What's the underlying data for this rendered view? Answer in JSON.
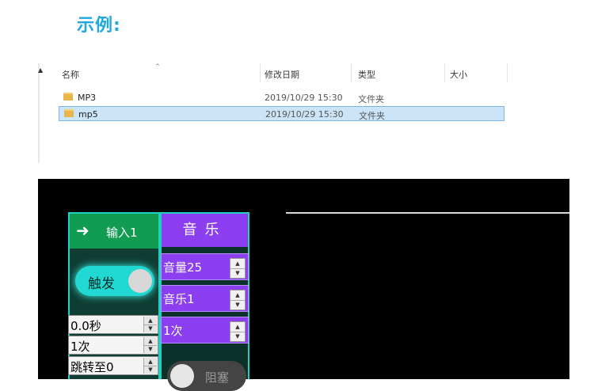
{
  "heading": "示例:",
  "explorer": {
    "columns": {
      "name": "名称",
      "date": "修改日期",
      "type": "类型",
      "size": "大小"
    },
    "rows": [
      {
        "name": "MP3",
        "date": "2019/10/29 15:30",
        "type": "文件夹",
        "selected": false
      },
      {
        "name": "mp5",
        "date": "2019/10/29 15:30",
        "type": "文件夹",
        "selected": true
      }
    ]
  },
  "panel": {
    "input_header": {
      "arrow": "➜",
      "label": "输入1"
    },
    "trigger": {
      "label": "触发"
    },
    "delay": {
      "value": "0.0秒"
    },
    "count": {
      "value": "1次"
    },
    "jump": {
      "value": "跳转至0"
    },
    "music_header": {
      "label": "音乐"
    },
    "volume": {
      "value": "音量25"
    },
    "track": {
      "value": "音乐1"
    },
    "music_count": {
      "value": "1次"
    },
    "block": {
      "label": "阻塞"
    }
  },
  "colors": {
    "heading": "#1fa8e2",
    "input_header": "#129c52",
    "music": "#8b3ff0",
    "accent": "#1fd0c0"
  }
}
